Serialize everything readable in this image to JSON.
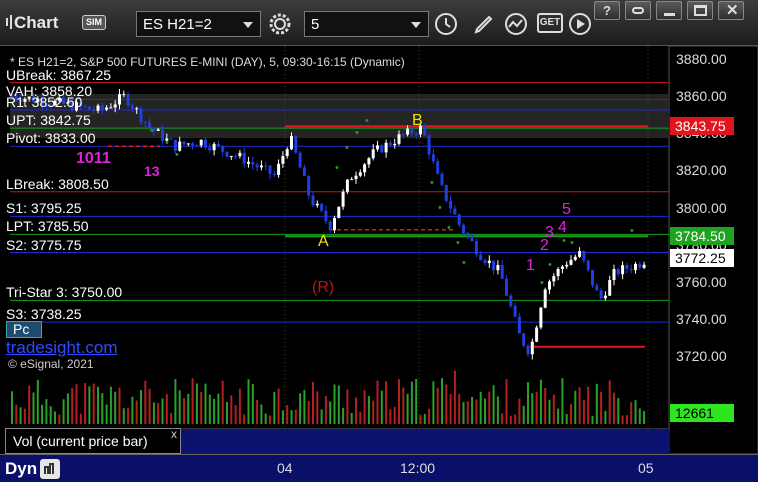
{
  "toolbar": {
    "title": "Chart",
    "sim_badge": "SIM",
    "symbol": "ES H21=2",
    "interval": "5",
    "get_label": "GET"
  },
  "chart": {
    "header": "* ES H21=2, S&P 500 FUTURES E-MINI (DAY), 5, 09:30-16:15 (Dynamic)",
    "levels": [
      {
        "key": "ubreak",
        "label": "UBreak: 3867.25",
        "price": 3867.25,
        "color": "#c8161d"
      },
      {
        "key": "vah",
        "label": "VAH: 3858.20",
        "price": 3858.2,
        "color": "#1f2ad6"
      },
      {
        "key": "r1",
        "label": "R1: 3852.50",
        "price": 3852.5,
        "color": "#1f2ad6"
      },
      {
        "key": "upt",
        "label": "UPT: 3842.75",
        "price": 3842.75,
        "color": "#17a01a"
      },
      {
        "key": "pivot",
        "label": "Pivot: 3833.00",
        "price": 3833.0,
        "color": "#1f2ad6"
      },
      {
        "key": "lbreak",
        "label": "LBreak: 3808.50",
        "price": 3808.5,
        "color": "#c8161d"
      },
      {
        "key": "s1",
        "label": "S1: 3795.25",
        "price": 3795.25,
        "color": "#1f2ad6"
      },
      {
        "key": "lpt",
        "label": "LPT: 3785.50",
        "price": 3785.5,
        "color": "#17a01a"
      },
      {
        "key": "s2",
        "label": "S2: 3775.75",
        "price": 3775.75,
        "color": "#1f2ad6"
      },
      {
        "key": "tristar",
        "label": "Tri-Star 3: 3750.00",
        "price": 3750.0,
        "color": "#17a01a"
      },
      {
        "key": "s3",
        "label": "S3: 3738.25",
        "price": 3738.25,
        "color": "#1f2ad6"
      }
    ],
    "price_ticks": [
      "3880.00",
      "3860.00",
      "3840.00",
      "3820.00",
      "3800.00",
      "3780.00",
      "3760.00",
      "3740.00",
      "3720.00"
    ],
    "tags": {
      "red": "3843.75",
      "green": "3784.50",
      "white": "3772.25",
      "volume": "12661"
    },
    "annotations": {
      "a": "A",
      "b": "B",
      "r": "(R)",
      "m1011": "1011",
      "m13": "13",
      "n1": "1",
      "n2": "2",
      "n3": "3",
      "n4": "4",
      "n5": "5"
    },
    "pc_badge": "Pc",
    "watermark": "tradesight.com",
    "copyright": "© eSignal, 2021",
    "colors": {
      "up": "#ffffff",
      "down": "#1f3fe0",
      "volume_up": "#2aa12a",
      "volume_down": "#b22020"
    }
  },
  "volume": {
    "label": "Vol (current price bar)",
    "close_glyph": "x"
  },
  "bottom": {
    "mode": "Dyn",
    "time_ticks": [
      "04",
      "12:00",
      "05"
    ]
  }
}
